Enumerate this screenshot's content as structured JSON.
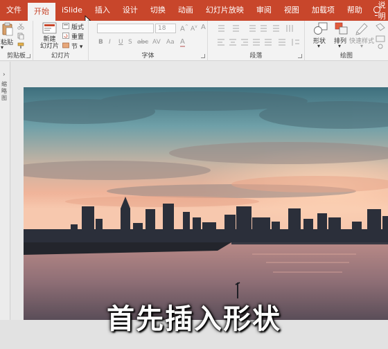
{
  "menu": {
    "tabs": [
      "文件",
      "开始",
      "iSlide",
      "插入",
      "设计",
      "切换",
      "动画",
      "幻灯片放映",
      "审阅",
      "视图",
      "加载项",
      "帮助"
    ],
    "active_tab": "开始",
    "tell_me": "操作说明搜索"
  },
  "ribbon": {
    "clipboard": {
      "paste": "粘贴",
      "label": "剪贴板"
    },
    "slides": {
      "new_slide": "新建\n幻灯片",
      "layout": "版式",
      "reset": "重置",
      "section": "节",
      "label": "幻灯片"
    },
    "font": {
      "size": "18",
      "label": "字体",
      "formats": [
        "B",
        "I",
        "U",
        "S",
        "abc",
        "AV",
        "Aa",
        "A"
      ]
    },
    "paragraph": {
      "label": "段落"
    },
    "drawing": {
      "shapes": "形状",
      "arrange": "排列",
      "quick_styles": "快速样式",
      "label": "绘图"
    }
  },
  "left_pane": {
    "label": "缩略图"
  },
  "caption": "首先插入形状",
  "colors": {
    "accent": "#c8462b"
  }
}
